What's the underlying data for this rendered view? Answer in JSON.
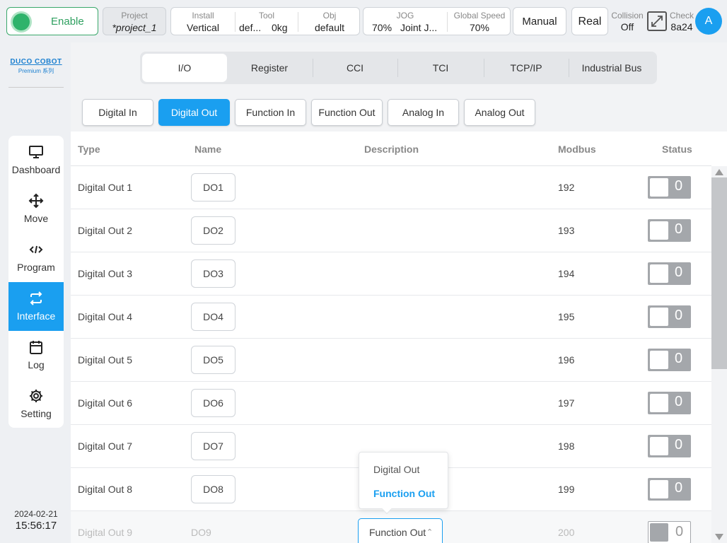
{
  "topbar": {
    "enable_label": "Enable",
    "project": {
      "label": "Project",
      "value": "*project_1"
    },
    "install": {
      "label": "Install",
      "value": "Vertical"
    },
    "tool": {
      "label": "Tool",
      "value": "def...",
      "weight": "0kg"
    },
    "obj": {
      "label": "Obj",
      "value": "default"
    },
    "jog": {
      "label": "JOG",
      "value": "70%",
      "mode": "Joint J..."
    },
    "global_speed": {
      "label": "Global Speed",
      "value": "70%"
    },
    "manual_label": "Manual",
    "real_label": "Real",
    "collision": {
      "label": "Collision",
      "value": "Off"
    },
    "check": {
      "label": "Check",
      "value": "8a24"
    },
    "avatar_letter": "A"
  },
  "brand": {
    "name": "DUCO COBOT",
    "sub": "Premium 系列"
  },
  "sidebar": {
    "items": [
      {
        "label": "Dashboard",
        "icon": "monitor-icon"
      },
      {
        "label": "Move",
        "icon": "move-arrows-icon"
      },
      {
        "label": "Program",
        "icon": "code-icon"
      },
      {
        "label": "Interface",
        "icon": "swap-arrows-icon",
        "active": true
      },
      {
        "label": "Log",
        "icon": "calendar-icon"
      },
      {
        "label": "Setting",
        "icon": "gear-icon"
      }
    ]
  },
  "datetime": {
    "date": "2024-02-21",
    "time": "15:56:17"
  },
  "tabs": [
    "I/O",
    "Register",
    "CCI",
    "TCI",
    "TCP/IP",
    "Industrial Bus"
  ],
  "subtabs": [
    "Digital In",
    "Digital Out",
    "Function In",
    "Function Out",
    "Analog In",
    "Analog Out"
  ],
  "table": {
    "headers": {
      "type": "Type",
      "name": "Name",
      "description": "Description",
      "modbus": "Modbus",
      "status": "Status"
    },
    "rows": [
      {
        "type": "Digital Out 1",
        "name": "DO1",
        "modbus": "192",
        "status": "0"
      },
      {
        "type": "Digital Out 2",
        "name": "DO2",
        "modbus": "193",
        "status": "0"
      },
      {
        "type": "Digital Out 3",
        "name": "DO3",
        "modbus": "194",
        "status": "0"
      },
      {
        "type": "Digital Out 4",
        "name": "DO4",
        "modbus": "195",
        "status": "0"
      },
      {
        "type": "Digital Out 5",
        "name": "DO5",
        "modbus": "196",
        "status": "0"
      },
      {
        "type": "Digital Out 6",
        "name": "DO6",
        "modbus": "197",
        "status": "0"
      },
      {
        "type": "Digital Out 7",
        "name": "DO7",
        "modbus": "198",
        "status": "0"
      },
      {
        "type": "Digital Out 8",
        "name": "DO8",
        "modbus": "199",
        "status": "0"
      },
      {
        "type": "Digital Out 9",
        "name": "DO9",
        "modbus": "200",
        "status": "0",
        "function_select": "Function Out"
      }
    ]
  },
  "dropdown": {
    "options": [
      "Digital Out",
      "Function Out"
    ],
    "selected": "Function Out"
  },
  "colors": {
    "accent": "#1a9ff0",
    "enable_green": "#2fb36b",
    "toggle_gray": "#a4a7ab"
  }
}
